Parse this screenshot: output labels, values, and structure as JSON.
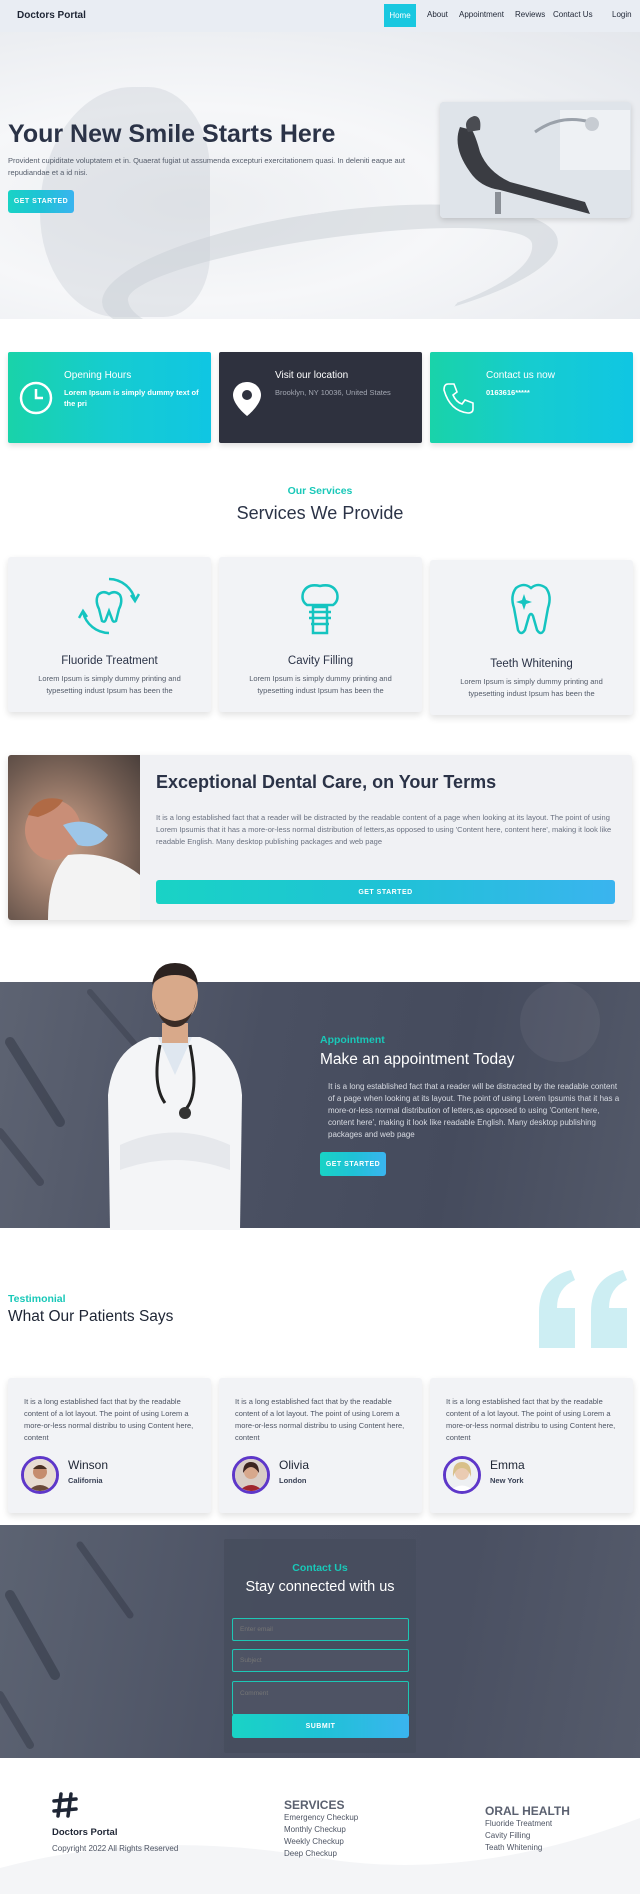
{
  "nav": {
    "brand": "Doctors Portal",
    "items": [
      "Home",
      "About",
      "Appointment",
      "Reviews",
      "Contact Us",
      "Login"
    ]
  },
  "hero": {
    "title": "Your New Smile Starts Here",
    "lead": "Provident cupiditate voluptatem et in. Quaerat fugiat ut assumenda excepturi exercitationem quasi. In deleniti eaque aut repudiandae et a id nisi.",
    "cta": "GET STARTED"
  },
  "info_cards": [
    {
      "title": "Opening Hours",
      "text": "Lorem Ipsum is simply dummy text of the pri",
      "icon": "clock-icon"
    },
    {
      "title": "Visit our location",
      "text": "Brooklyn, NY 10036, United States",
      "icon": "location-pin-icon"
    },
    {
      "title": "Contact us now",
      "text": "0163616*****",
      "icon": "phone-icon"
    }
  ],
  "services": {
    "eyebrow": "Our Services",
    "title": "Services We Provide",
    "items": [
      {
        "name": "Fluoride Treatment",
        "desc": "Lorem Ipsum is simply dummy printing and typesetting indust Ipsum has been the",
        "icon": "tooth-refresh-icon"
      },
      {
        "name": "Cavity Filling",
        "desc": "Lorem Ipsum is simply dummy printing and typesetting indust Ipsum has been the",
        "icon": "dental-implant-icon"
      },
      {
        "name": "Teeth Whitening",
        "desc": "Lorem Ipsum is simply dummy printing and typesetting indust Ipsum has been the",
        "icon": "sparkle-tooth-icon"
      }
    ]
  },
  "exceptional": {
    "title": "Exceptional Dental Care, on Your Terms",
    "text": "It is a long established fact that a reader will be distracted by the readable content of a page when looking at its layout. The point of using Lorem Ipsumis that it has a more-or-less normal distribution of letters,as opposed to using 'Content here, content here', making it look like readable English. Many desktop publishing packages and web page",
    "cta": "GET STARTED"
  },
  "appointment": {
    "eyebrow": "Appointment",
    "title": "Make an appointment Today",
    "text": "It is a long established fact that a reader will be distracted by the readable content of a page when looking at its layout. The point of using Lorem Ipsumis that it has a more-or-less normal distribution of letters,as opposed to using 'Content here, content here', making it look like readable English. Many desktop publishing packages and web page",
    "cta": "GET STARTED"
  },
  "testimonial": {
    "eyebrow": "Testimonial",
    "title": "What Our Patients Says",
    "items": [
      {
        "text": "It is a long established fact that by the readable content of a lot layout. The point of using Lorem a more-or-less normal distribu to using Content here, content",
        "name": "Winson",
        "location": "California"
      },
      {
        "text": "It is a long established fact that by the readable content of a lot layout. The point of using Lorem a more-or-less normal distribu to using Content here, content",
        "name": "Olivia",
        "location": "London"
      },
      {
        "text": "It is a long established fact that by the readable content of a lot layout. The point of using Lorem a more-or-less normal distribu to using Content here, content",
        "name": "Emma",
        "location": "New York"
      }
    ]
  },
  "contact": {
    "eyebrow": "Contact Us",
    "title": "Stay connected with us",
    "email_placeholder": "Enter email",
    "subject_placeholder": "Subject",
    "comment_placeholder": "Comment",
    "submit": "SUBMIT"
  },
  "footer": {
    "brand": "Doctors Portal",
    "copyright": "Copyright 2022 All Rights Reserved",
    "services_title": "SERVICES",
    "services": [
      "Emergency Checkup",
      "Monthly Checkup",
      "Weekly Checkup",
      "Deep Checkup"
    ],
    "oral_title": "ORAL HEALTH",
    "oral": [
      "Fluoride Treatment",
      "Cavity Filling",
      "Teath Whitening"
    ]
  },
  "colors": {
    "accent": "#19c8b8",
    "accent_blue": "#3ab4ef",
    "dark": "#2e313e",
    "nav_active": "#19c8e0"
  }
}
